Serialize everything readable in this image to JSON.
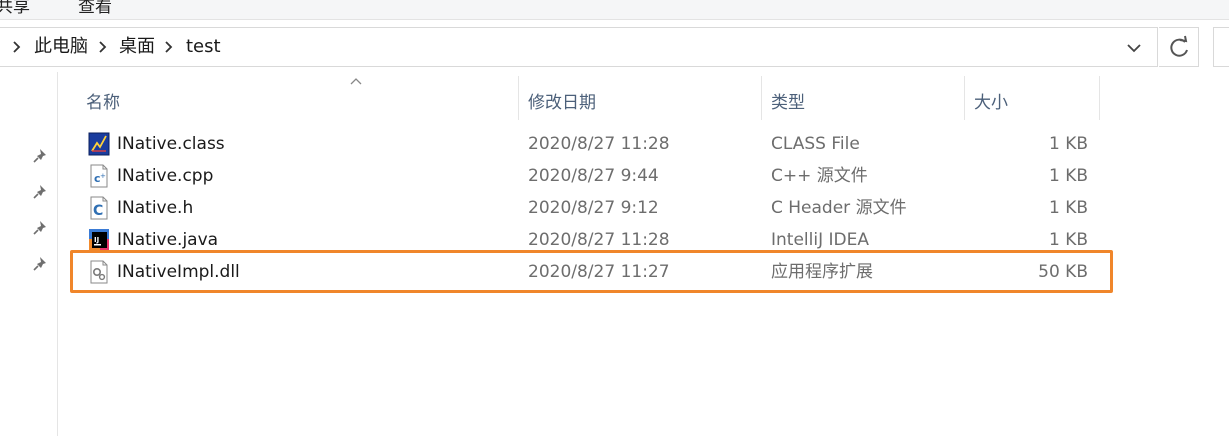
{
  "ribbon": {
    "tabs": [
      {
        "label": "共享"
      },
      {
        "label": "查看"
      }
    ]
  },
  "address_bar": {
    "breadcrumbs": [
      {
        "label": "此电脑"
      },
      {
        "label": "桌面"
      },
      {
        "label": "test"
      }
    ],
    "dropdown_icon": "chevron-down-icon",
    "refresh_icon": "refresh-icon"
  },
  "nav_pane": {
    "pins": [
      "pin-icon",
      "pin-icon",
      "pin-icon",
      "pin-icon"
    ]
  },
  "file_list": {
    "columns": {
      "name": "名称",
      "date": "修改日期",
      "type": "类型",
      "size": "大小"
    },
    "sort_column": "name",
    "files": [
      {
        "name": "INative.class",
        "date": "2020/8/27 11:28",
        "type": "CLASS File",
        "size": "1 KB",
        "icon": "class-file-icon"
      },
      {
        "name": "INative.cpp",
        "date": "2020/8/27 9:44",
        "type": "C++ 源文件",
        "size": "1 KB",
        "icon": "cpp-file-icon"
      },
      {
        "name": "INative.h",
        "date": "2020/8/27 9:12",
        "type": "C Header 源文件",
        "size": "1 KB",
        "icon": "header-file-icon"
      },
      {
        "name": "INative.java",
        "date": "2020/8/27 11:28",
        "type": "IntelliJ IDEA",
        "size": "1 KB",
        "icon": "intellij-icon"
      },
      {
        "name": "INativeImpl.dll",
        "date": "2020/8/27 11:27",
        "type": "应用程序扩展",
        "size": "50 KB",
        "icon": "dll-file-icon"
      }
    ]
  },
  "annotation": {
    "highlight_color": "#f0862a",
    "highlighted_file": "INativeImpl.dll"
  }
}
